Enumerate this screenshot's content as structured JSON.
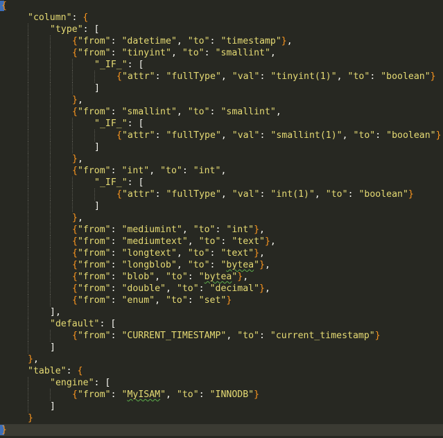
{
  "editor": {
    "lines": [
      {
        "indent": 0,
        "tokens": [
          {
            "t": "{",
            "k": "brace"
          }
        ],
        "cursor_start": true
      },
      {
        "indent": 1,
        "tokens": [
          {
            "t": "\"column\"",
            "k": "str"
          },
          {
            "t": ": ",
            "k": "punc"
          },
          {
            "t": "{",
            "k": "brace"
          }
        ]
      },
      {
        "indent": 2,
        "tokens": [
          {
            "t": "\"type\"",
            "k": "str"
          },
          {
            "t": ": ",
            "k": "punc"
          },
          {
            "t": "[",
            "k": "bracket"
          }
        ]
      },
      {
        "indent": 3,
        "tokens": [
          {
            "t": "{",
            "k": "brace"
          },
          {
            "t": "\"from\"",
            "k": "str"
          },
          {
            "t": ": ",
            "k": "punc"
          },
          {
            "t": "\"datetime\"",
            "k": "str"
          },
          {
            "t": ", ",
            "k": "punc"
          },
          {
            "t": "\"to\"",
            "k": "str"
          },
          {
            "t": ": ",
            "k": "punc"
          },
          {
            "t": "\"timestamp\"",
            "k": "str"
          },
          {
            "t": "}",
            "k": "brace"
          },
          {
            "t": ",",
            "k": "punc"
          }
        ]
      },
      {
        "indent": 3,
        "tokens": [
          {
            "t": "{",
            "k": "brace"
          },
          {
            "t": "\"from\"",
            "k": "str"
          },
          {
            "t": ": ",
            "k": "punc"
          },
          {
            "t": "\"tinyint\"",
            "k": "str"
          },
          {
            "t": ", ",
            "k": "punc"
          },
          {
            "t": "\"to\"",
            "k": "str"
          },
          {
            "t": ": ",
            "k": "punc"
          },
          {
            "t": "\"smallint\"",
            "k": "str"
          },
          {
            "t": ",",
            "k": "punc"
          }
        ]
      },
      {
        "indent": 4,
        "tokens": [
          {
            "t": "\"_IF_\"",
            "k": "str"
          },
          {
            "t": ": ",
            "k": "punc"
          },
          {
            "t": "[",
            "k": "bracket"
          }
        ]
      },
      {
        "indent": 5,
        "tokens": [
          {
            "t": "{",
            "k": "brace"
          },
          {
            "t": "\"attr\"",
            "k": "str"
          },
          {
            "t": ": ",
            "k": "punc"
          },
          {
            "t": "\"fullType\"",
            "k": "str"
          },
          {
            "t": ", ",
            "k": "punc"
          },
          {
            "t": "\"val\"",
            "k": "str"
          },
          {
            "t": ": ",
            "k": "punc"
          },
          {
            "t": "\"tinyint(1)\"",
            "k": "str"
          },
          {
            "t": ", ",
            "k": "punc"
          },
          {
            "t": "\"to\"",
            "k": "str"
          },
          {
            "t": ": ",
            "k": "punc"
          },
          {
            "t": "\"boolean\"",
            "k": "str"
          },
          {
            "t": "}",
            "k": "brace"
          }
        ]
      },
      {
        "indent": 4,
        "tokens": [
          {
            "t": "]",
            "k": "bracket"
          }
        ]
      },
      {
        "indent": 3,
        "tokens": [
          {
            "t": "}",
            "k": "brace"
          },
          {
            "t": ",",
            "k": "punc"
          }
        ]
      },
      {
        "indent": 3,
        "tokens": [
          {
            "t": "{",
            "k": "brace"
          },
          {
            "t": "\"from\"",
            "k": "str"
          },
          {
            "t": ": ",
            "k": "punc"
          },
          {
            "t": "\"smallint\"",
            "k": "str"
          },
          {
            "t": ", ",
            "k": "punc"
          },
          {
            "t": "\"to\"",
            "k": "str"
          },
          {
            "t": ": ",
            "k": "punc"
          },
          {
            "t": "\"smallint\"",
            "k": "str"
          },
          {
            "t": ",",
            "k": "punc"
          }
        ]
      },
      {
        "indent": 4,
        "tokens": [
          {
            "t": "\"_IF_\"",
            "k": "str"
          },
          {
            "t": ": ",
            "k": "punc"
          },
          {
            "t": "[",
            "k": "bracket"
          }
        ]
      },
      {
        "indent": 5,
        "tokens": [
          {
            "t": "{",
            "k": "brace"
          },
          {
            "t": "\"attr\"",
            "k": "str"
          },
          {
            "t": ": ",
            "k": "punc"
          },
          {
            "t": "\"fullType\"",
            "k": "str"
          },
          {
            "t": ", ",
            "k": "punc"
          },
          {
            "t": "\"val\"",
            "k": "str"
          },
          {
            "t": ": ",
            "k": "punc"
          },
          {
            "t": "\"smallint(1)\"",
            "k": "str"
          },
          {
            "t": ", ",
            "k": "punc"
          },
          {
            "t": "\"to\"",
            "k": "str"
          },
          {
            "t": ": ",
            "k": "punc"
          },
          {
            "t": "\"boolean\"",
            "k": "str"
          },
          {
            "t": "}",
            "k": "brace"
          }
        ]
      },
      {
        "indent": 4,
        "tokens": [
          {
            "t": "]",
            "k": "bracket"
          }
        ]
      },
      {
        "indent": 3,
        "tokens": [
          {
            "t": "}",
            "k": "brace"
          },
          {
            "t": ",",
            "k": "punc"
          }
        ]
      },
      {
        "indent": 3,
        "tokens": [
          {
            "t": "{",
            "k": "brace"
          },
          {
            "t": "\"from\"",
            "k": "str"
          },
          {
            "t": ": ",
            "k": "punc"
          },
          {
            "t": "\"int\"",
            "k": "str"
          },
          {
            "t": ", ",
            "k": "punc"
          },
          {
            "t": "\"to\"",
            "k": "str"
          },
          {
            "t": ": ",
            "k": "punc"
          },
          {
            "t": "\"int\"",
            "k": "str"
          },
          {
            "t": ",",
            "k": "punc"
          }
        ]
      },
      {
        "indent": 4,
        "tokens": [
          {
            "t": "\"_IF_\"",
            "k": "str"
          },
          {
            "t": ": ",
            "k": "punc"
          },
          {
            "t": "[",
            "k": "bracket"
          }
        ]
      },
      {
        "indent": 5,
        "tokens": [
          {
            "t": "{",
            "k": "brace"
          },
          {
            "t": "\"attr\"",
            "k": "str"
          },
          {
            "t": ": ",
            "k": "punc"
          },
          {
            "t": "\"fullType\"",
            "k": "str"
          },
          {
            "t": ", ",
            "k": "punc"
          },
          {
            "t": "\"val\"",
            "k": "str"
          },
          {
            "t": ": ",
            "k": "punc"
          },
          {
            "t": "\"int(1)\"",
            "k": "str"
          },
          {
            "t": ", ",
            "k": "punc"
          },
          {
            "t": "\"to\"",
            "k": "str"
          },
          {
            "t": ": ",
            "k": "punc"
          },
          {
            "t": "\"boolean\"",
            "k": "str"
          },
          {
            "t": "}",
            "k": "brace"
          }
        ]
      },
      {
        "indent": 4,
        "tokens": [
          {
            "t": "]",
            "k": "bracket"
          }
        ]
      },
      {
        "indent": 3,
        "tokens": [
          {
            "t": "}",
            "k": "brace"
          },
          {
            "t": ",",
            "k": "punc"
          }
        ]
      },
      {
        "indent": 3,
        "tokens": [
          {
            "t": "{",
            "k": "brace"
          },
          {
            "t": "\"from\"",
            "k": "str"
          },
          {
            "t": ": ",
            "k": "punc"
          },
          {
            "t": "\"mediumint\"",
            "k": "str"
          },
          {
            "t": ", ",
            "k": "punc"
          },
          {
            "t": "\"to\"",
            "k": "str"
          },
          {
            "t": ": ",
            "k": "punc"
          },
          {
            "t": "\"int\"",
            "k": "str"
          },
          {
            "t": "}",
            "k": "brace"
          },
          {
            "t": ",",
            "k": "punc"
          }
        ]
      },
      {
        "indent": 3,
        "tokens": [
          {
            "t": "{",
            "k": "brace"
          },
          {
            "t": "\"from\"",
            "k": "str"
          },
          {
            "t": ": ",
            "k": "punc"
          },
          {
            "t": "\"mediumtext\"",
            "k": "str"
          },
          {
            "t": ", ",
            "k": "punc"
          },
          {
            "t": "\"to\"",
            "k": "str"
          },
          {
            "t": ": ",
            "k": "punc"
          },
          {
            "t": "\"text\"",
            "k": "str"
          },
          {
            "t": "}",
            "k": "brace"
          },
          {
            "t": ",",
            "k": "punc"
          }
        ]
      },
      {
        "indent": 3,
        "tokens": [
          {
            "t": "{",
            "k": "brace"
          },
          {
            "t": "\"from\"",
            "k": "str"
          },
          {
            "t": ": ",
            "k": "punc"
          },
          {
            "t": "\"longtext\"",
            "k": "str"
          },
          {
            "t": ", ",
            "k": "punc"
          },
          {
            "t": "\"to\"",
            "k": "str"
          },
          {
            "t": ": ",
            "k": "punc"
          },
          {
            "t": "\"text\"",
            "k": "str"
          },
          {
            "t": "}",
            "k": "brace"
          },
          {
            "t": ",",
            "k": "punc"
          }
        ]
      },
      {
        "indent": 3,
        "tokens": [
          {
            "t": "{",
            "k": "brace"
          },
          {
            "t": "\"from\"",
            "k": "str"
          },
          {
            "t": ": ",
            "k": "punc"
          },
          {
            "t": "\"longblob\"",
            "k": "str"
          },
          {
            "t": ", ",
            "k": "punc"
          },
          {
            "t": "\"to\"",
            "k": "str"
          },
          {
            "t": ": ",
            "k": "punc"
          },
          {
            "t": "\"",
            "k": "str"
          },
          {
            "t": "bytea",
            "k": "str",
            "squiggle": true
          },
          {
            "t": "\"",
            "k": "str"
          },
          {
            "t": "}",
            "k": "brace"
          },
          {
            "t": ",",
            "k": "punc"
          }
        ]
      },
      {
        "indent": 3,
        "tokens": [
          {
            "t": "{",
            "k": "brace"
          },
          {
            "t": "\"from\"",
            "k": "str"
          },
          {
            "t": ": ",
            "k": "punc"
          },
          {
            "t": "\"blob\"",
            "k": "str"
          },
          {
            "t": ", ",
            "k": "punc"
          },
          {
            "t": "\"to\"",
            "k": "str"
          },
          {
            "t": ": ",
            "k": "punc"
          },
          {
            "t": "\"",
            "k": "str"
          },
          {
            "t": "bytea",
            "k": "str",
            "squiggle": true
          },
          {
            "t": "\"",
            "k": "str"
          },
          {
            "t": "}",
            "k": "brace"
          },
          {
            "t": ",",
            "k": "punc"
          }
        ]
      },
      {
        "indent": 3,
        "tokens": [
          {
            "t": "{",
            "k": "brace"
          },
          {
            "t": "\"from\"",
            "k": "str"
          },
          {
            "t": ": ",
            "k": "punc"
          },
          {
            "t": "\"double\"",
            "k": "str"
          },
          {
            "t": ", ",
            "k": "punc"
          },
          {
            "t": "\"to\"",
            "k": "str"
          },
          {
            "t": ": ",
            "k": "punc"
          },
          {
            "t": "\"decimal\"",
            "k": "str"
          },
          {
            "t": "}",
            "k": "brace"
          },
          {
            "t": ",",
            "k": "punc"
          }
        ]
      },
      {
        "indent": 3,
        "tokens": [
          {
            "t": "{",
            "k": "brace"
          },
          {
            "t": "\"from\"",
            "k": "str"
          },
          {
            "t": ": ",
            "k": "punc"
          },
          {
            "t": "\"enum\"",
            "k": "str"
          },
          {
            "t": ", ",
            "k": "punc"
          },
          {
            "t": "\"to\"",
            "k": "str"
          },
          {
            "t": ": ",
            "k": "punc"
          },
          {
            "t": "\"set\"",
            "k": "str"
          },
          {
            "t": "}",
            "k": "brace"
          }
        ]
      },
      {
        "indent": 2,
        "tokens": [
          {
            "t": "]",
            "k": "bracket"
          },
          {
            "t": ",",
            "k": "punc"
          }
        ]
      },
      {
        "indent": 2,
        "tokens": [
          {
            "t": "\"default\"",
            "k": "str"
          },
          {
            "t": ": ",
            "k": "punc"
          },
          {
            "t": "[",
            "k": "bracket"
          }
        ]
      },
      {
        "indent": 3,
        "tokens": [
          {
            "t": "{",
            "k": "brace"
          },
          {
            "t": "\"from\"",
            "k": "str"
          },
          {
            "t": ": ",
            "k": "punc"
          },
          {
            "t": "\"CURRENT_TIMESTAMP\"",
            "k": "str"
          },
          {
            "t": ", ",
            "k": "punc"
          },
          {
            "t": "\"to\"",
            "k": "str"
          },
          {
            "t": ": ",
            "k": "punc"
          },
          {
            "t": "\"current_timestamp\"",
            "k": "str"
          },
          {
            "t": "}",
            "k": "brace"
          }
        ]
      },
      {
        "indent": 2,
        "tokens": [
          {
            "t": "]",
            "k": "bracket"
          }
        ]
      },
      {
        "indent": 1,
        "tokens": [
          {
            "t": "}",
            "k": "brace"
          },
          {
            "t": ",",
            "k": "punc"
          }
        ]
      },
      {
        "indent": 1,
        "tokens": [
          {
            "t": "\"table\"",
            "k": "str"
          },
          {
            "t": ": ",
            "k": "punc"
          },
          {
            "t": "{",
            "k": "brace"
          }
        ]
      },
      {
        "indent": 2,
        "tokens": [
          {
            "t": "\"engine\"",
            "k": "str"
          },
          {
            "t": ": ",
            "k": "punc"
          },
          {
            "t": "[",
            "k": "bracket"
          }
        ]
      },
      {
        "indent": 3,
        "tokens": [
          {
            "t": "{",
            "k": "brace"
          },
          {
            "t": "\"from\"",
            "k": "str"
          },
          {
            "t": ": ",
            "k": "punc"
          },
          {
            "t": "\"",
            "k": "str"
          },
          {
            "t": "MyISAM",
            "k": "str",
            "squiggle": true
          },
          {
            "t": "\"",
            "k": "str"
          },
          {
            "t": ", ",
            "k": "punc"
          },
          {
            "t": "\"to\"",
            "k": "str"
          },
          {
            "t": ": ",
            "k": "punc"
          },
          {
            "t": "\"INNODB\"",
            "k": "str"
          },
          {
            "t": "}",
            "k": "brace"
          }
        ]
      },
      {
        "indent": 2,
        "tokens": [
          {
            "t": "]",
            "k": "bracket"
          }
        ]
      },
      {
        "indent": 1,
        "tokens": [
          {
            "t": "}",
            "k": "brace"
          }
        ]
      },
      {
        "indent": 0,
        "tokens": [
          {
            "t": "}",
            "k": "brace"
          }
        ],
        "current": true,
        "cursor_start": true
      }
    ]
  }
}
